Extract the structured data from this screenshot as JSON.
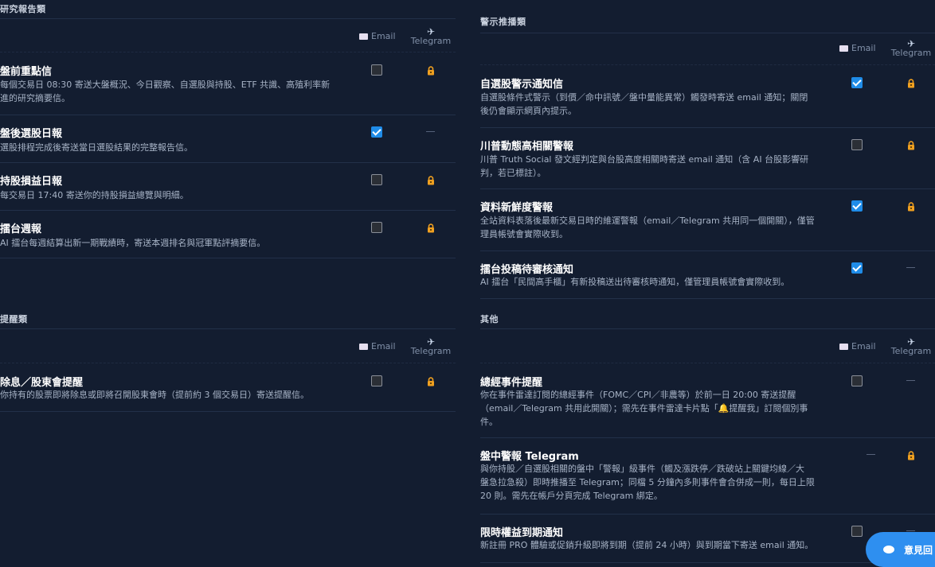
{
  "headers": {
    "email": "Email",
    "telegram": "Telegram"
  },
  "left": {
    "research": {
      "title": "研究報告類",
      "rows": [
        {
          "title": "盤前重點信",
          "desc_lines": [
            "每個交易日 08:30 寄送大盤概況、今日觀察、自選股與持股、ETF 共識、高殖利率新",
            "進的研究摘要信。"
          ],
          "email": "off",
          "telegram": "lock"
        },
        {
          "title": "盤後選股日報",
          "desc_lines": [
            "選股排程完成後寄送當日選股結果的完整報告信。"
          ],
          "email": "on",
          "telegram": "dash"
        },
        {
          "title": "持股損益日報",
          "desc_lines": [
            "每交易日 17:40 寄送你的持股損益總覽與明細。"
          ],
          "email": "off",
          "telegram": "lock"
        },
        {
          "title": "擂台週報",
          "desc_lines": [
            "AI 擂台每週結算出新一期戰績時，寄送本週排名與冠軍點評摘要信。"
          ],
          "email": "off",
          "telegram": "lock"
        }
      ]
    },
    "reminder": {
      "title": "提醒類",
      "rows": [
        {
          "title": "除息／股東會提醒",
          "desc_lines": [
            "你持有的股票即將除息或即將召開股東會時（提前約 3 個交易日）寄送提醒信。"
          ],
          "email": "off",
          "telegram": "lock"
        }
      ]
    }
  },
  "right": {
    "alerts": {
      "title": "警示推播類",
      "rows": [
        {
          "title": "自選股警示通知信",
          "desc_lines": [
            "自選股條件式警示（到價／命中訊號／盤中量能異常）觸發時寄送 email 通知；關閉",
            "後仍會顯示網頁內提示。"
          ],
          "email": "on",
          "telegram": "lock"
        },
        {
          "title": "川普動態高相關警報",
          "desc_lines": [
            "川普 Truth Social 發文經判定與台股高度相關時寄送 email 通知（含 AI 台股影響研",
            "判，若已標註）。"
          ],
          "email": "off",
          "telegram": "lock"
        },
        {
          "title": "資料新鮮度警報",
          "desc_lines": [
            "全站資料表落後最新交易日時的維運警報（email／Telegram 共用同一個開關），僅管",
            "理員帳號會實際收到。"
          ],
          "email": "on",
          "telegram": "lock"
        },
        {
          "title": "擂台投稿待審核通知",
          "desc_lines": [
            "AI 擂台「民間高手櫃」有新投稿送出待審核時通知，僅管理員帳號會實際收到。"
          ],
          "email": "on",
          "telegram": "dash"
        }
      ]
    },
    "other": {
      "title": "其他",
      "rows": [
        {
          "title": "總經事件提醒",
          "desc_lines": [
            "你在事件雷達訂閱的總經事件（FOMC／CPI／非農等）於前一日 20:00 寄送提醒",
            "（email／Telegram 共用此開關）；需先在事件雷達卡片點「🔔提醒我」訂閱個別事",
            "件。"
          ],
          "email": "off",
          "telegram": "dash"
        },
        {
          "title": "盤中警報 Telegram",
          "desc_lines": [
            "與你持股／自選股相關的盤中「警報」級事件（觸及漲跌停／跌破站上關鍵均線／大",
            "盤急拉急殺）即時推播至 Telegram；同檔 5 分鐘內多則事件會合併成一則，每日上限",
            "20 則。需先在帳戶分頁完成 Telegram 綁定。"
          ],
          "email": "dash",
          "telegram": "lock"
        },
        {
          "title": "限時權益到期通知",
          "desc_lines": [
            "新註冊 PRO 體驗或促銷升級即將到期（提前 24 小時）與到期當下寄送 email 通知。"
          ],
          "email": "off",
          "telegram": "dash"
        }
      ]
    }
  },
  "feedback": {
    "label": "意見回"
  },
  "colors": {
    "bg": "#131d30",
    "accent": "#1f8ce8",
    "lock": "#f0a020"
  }
}
